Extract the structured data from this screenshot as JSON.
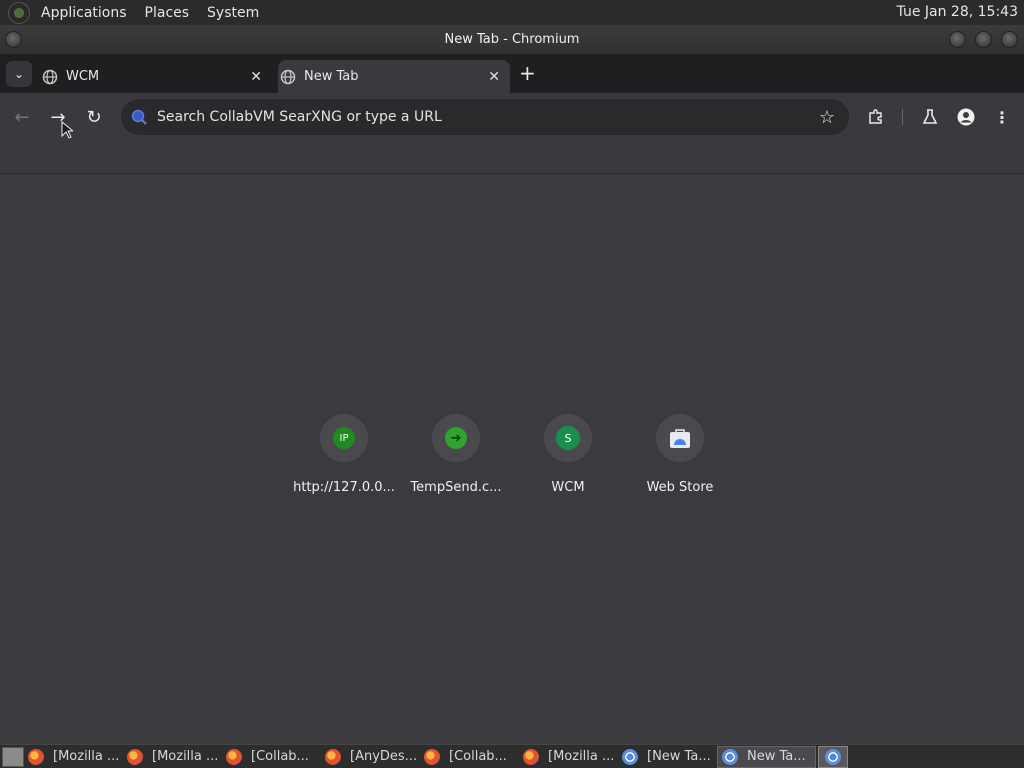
{
  "system_bar": {
    "menus": [
      "Applications",
      "Places",
      "System"
    ],
    "clock": "Tue Jan 28, 15:43"
  },
  "window": {
    "title": "New Tab - Chromium"
  },
  "tabs": [
    {
      "label": "WCM",
      "icon": "globe-icon"
    },
    {
      "label": "New Tab",
      "icon": "globe-icon",
      "active": true
    }
  ],
  "omnibox": {
    "placeholder": "Search CollabVM SearXNG or type a URL"
  },
  "shortcuts": [
    {
      "label": "http://127.0.0...",
      "icon_text": "IP",
      "color": "#1f8a1f"
    },
    {
      "label": "TempSend.c...",
      "icon_text": "➔",
      "color": "#2fa32f"
    },
    {
      "label": "WCM",
      "icon_text": "S",
      "color": "#1a8f4a"
    },
    {
      "label": "Web Store",
      "icon_text": "",
      "color": "#4285f4"
    }
  ],
  "taskbar": {
    "items": [
      {
        "label": "[Mozilla ...",
        "icon": "firefox-icon"
      },
      {
        "label": "[Mozilla ...",
        "icon": "firefox-icon"
      },
      {
        "label": "[Collab...",
        "icon": "firefox-icon"
      },
      {
        "label": "[AnyDes...",
        "icon": "firefox-icon"
      },
      {
        "label": "[Collab...",
        "icon": "firefox-icon"
      },
      {
        "label": "[Mozilla ...",
        "icon": "firefox-icon"
      },
      {
        "label": "[New Ta...",
        "icon": "chromium-icon"
      },
      {
        "label": "New Ta...",
        "icon": "chromium-icon",
        "active": true
      }
    ]
  }
}
